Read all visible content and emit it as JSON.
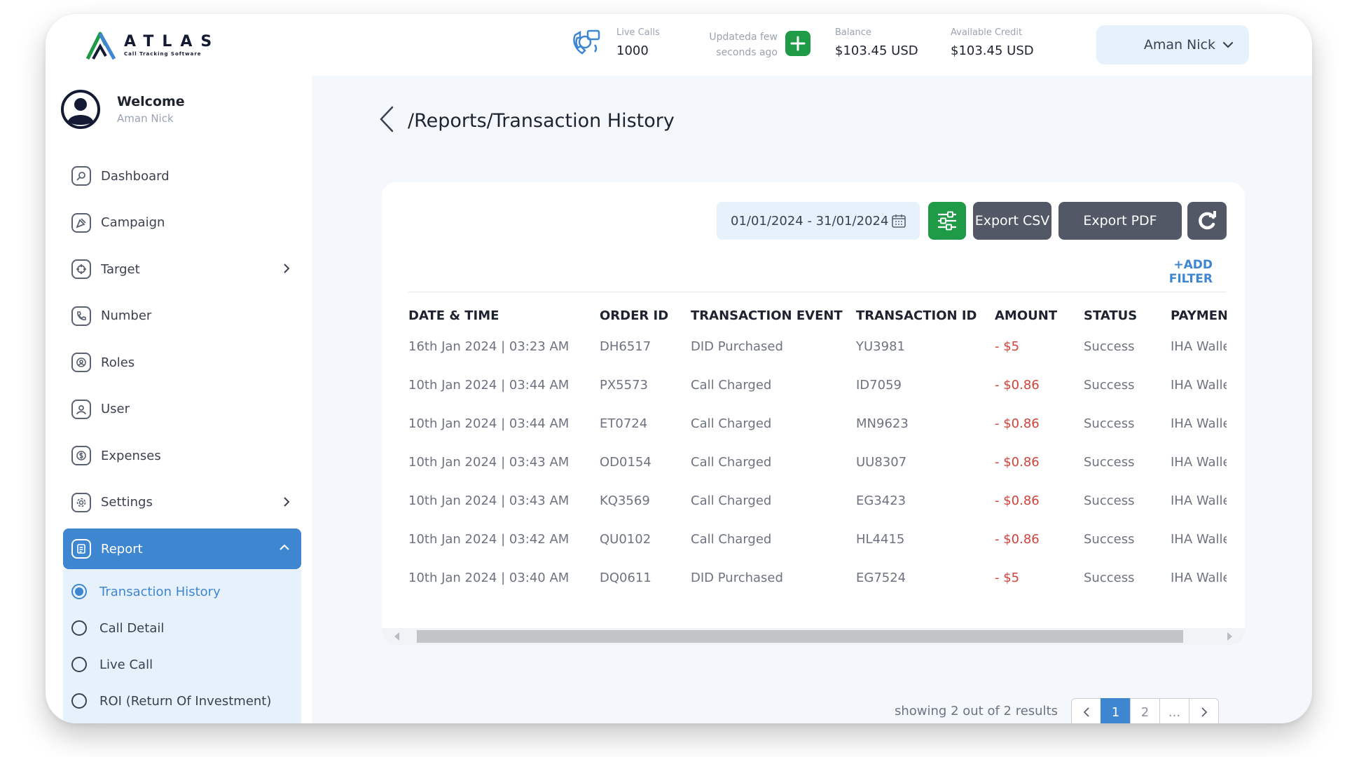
{
  "brand": {
    "name": "ATLAS",
    "tagline": "Call Tracking Software"
  },
  "header": {
    "live_calls_label": "Live Calls",
    "live_calls_value": "1000",
    "updated_text": "Updateda few seconds ago",
    "balance_label": "Balance",
    "balance_value": "$103.45 USD",
    "credit_label": "Available Credit",
    "credit_value": "$103.45 USD",
    "user_name": "Aman Nick"
  },
  "sidebar": {
    "welcome_title": "Welcome",
    "welcome_user": "Aman Nick",
    "items": [
      {
        "label": "Dashboard"
      },
      {
        "label": "Campaign"
      },
      {
        "label": "Target"
      },
      {
        "label": "Number"
      },
      {
        "label": "Roles"
      },
      {
        "label": "User"
      },
      {
        "label": "Expenses"
      },
      {
        "label": "Settings"
      },
      {
        "label": "Report"
      }
    ],
    "report_sub": [
      {
        "label": "Transaction History"
      },
      {
        "label": "Call Detail"
      },
      {
        "label": "Live Call"
      },
      {
        "label": "ROI (Return Of Investment)"
      }
    ]
  },
  "page": {
    "title": "/Reports/Transaction History"
  },
  "toolbar": {
    "date_range": "01/01/2024 - 31/01/2024",
    "export_csv": "Export CSV",
    "export_pdf": "Export PDF",
    "add_filter": "+ADD FILTER"
  },
  "table": {
    "headers": [
      "DATE & TIME",
      "ORDER ID",
      "TRANSACTION EVENT",
      "TRANSACTION ID",
      "AMOUNT",
      "STATUS",
      "PAYMENT"
    ],
    "rows": [
      [
        "16th Jan 2024 | 03:23 AM",
        "DH6517",
        "DID Purchased",
        "YU3981",
        "- $5",
        "Success",
        "IHA Wallet"
      ],
      [
        "10th Jan 2024 | 03:44 AM",
        "PX5573",
        "Call Charged",
        "ID7059",
        "- $0.86",
        "Success",
        "IHA Wallet"
      ],
      [
        "10th Jan 2024 | 03:44 AM",
        "ET0724",
        "Call Charged",
        "MN9623",
        "- $0.86",
        "Success",
        "IHA Wallet"
      ],
      [
        "10th Jan 2024 | 03:43 AM",
        "OD0154",
        "Call Charged",
        "UU8307",
        "- $0.86",
        "Success",
        "IHA Wallet"
      ],
      [
        "10th Jan 2024 | 03:43 AM",
        "KQ3569",
        "Call Charged",
        "EG3423",
        "- $0.86",
        "Success",
        "IHA Wallet"
      ],
      [
        "10th Jan 2024 | 03:42 AM",
        "QU0102",
        "Call Charged",
        "HL4415",
        "- $0.86",
        "Success",
        "IHA Wallet"
      ],
      [
        "10th Jan 2024 | 03:40 AM",
        "DQ0611",
        "DID Purchased",
        "EG7524",
        "- $5",
        "Success",
        "IHA Wallet"
      ]
    ]
  },
  "pagination": {
    "results_text": "showing 2 out of 2 results",
    "pages": [
      "1",
      "2",
      "..."
    ]
  },
  "colors": {
    "accent": "#3f86d1",
    "green": "#1f9a47",
    "negative": "#d0433b",
    "button_dark": "#525866"
  }
}
